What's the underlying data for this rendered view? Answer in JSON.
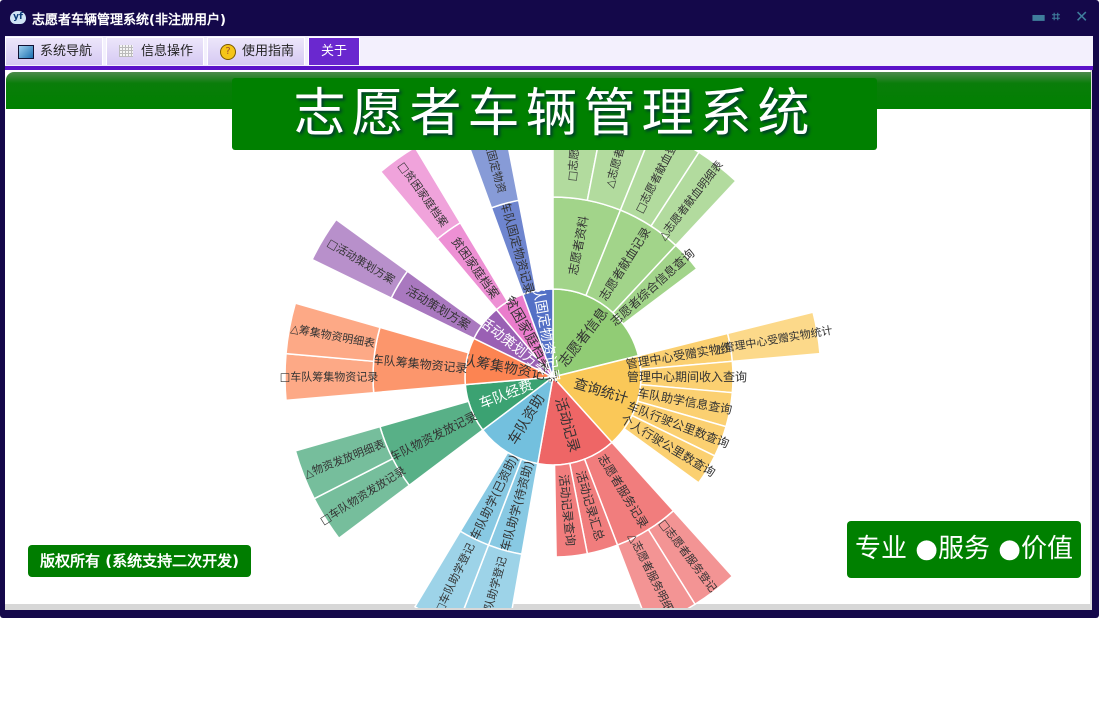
{
  "window": {
    "title": "志愿者车辆管理系统(非注册用户)",
    "app_icon": "yf",
    "controls": [
      "minimize-icon",
      "restore-icon",
      "close-icon"
    ]
  },
  "tabs": [
    {
      "label": "系统导航",
      "icon": "monitor-icon"
    },
    {
      "label": "信息操作",
      "icon": "grid-icon"
    },
    {
      "label": "使用指南",
      "icon": "help-icon"
    },
    {
      "label": "关于",
      "icon": "",
      "active": true
    }
  ],
  "banner": {
    "title": "志愿者车辆管理系统"
  },
  "footer": {
    "copyright": "版权所有 (系统支持二次开发)",
    "slogan": "专业 ●服务 ●价值"
  },
  "colors": {
    "accent": "#5b12c9",
    "banner": "#008000",
    "titlebar": "#14084a"
  },
  "chart_data": {
    "type": "sunburst",
    "palette": [
      "#91cc75",
      "#fac858",
      "#ee6666",
      "#73c0de",
      "#3ba272",
      "#fc8452",
      "#9a60b4",
      "#ea7ccc",
      "#5470c6"
    ],
    "nodes": [
      {
        "name": "志愿者信息",
        "value": 76,
        "children": [
          {
            "name": "志愿者资料",
            "value": 22,
            "children": [
              {
                "name": "□志愿者信",
                "value": 11
              },
              {
                "name": "△志愿者信",
                "value": 11
              }
            ]
          },
          {
            "name": "志愿者献血记录",
            "value": 21,
            "children": [
              {
                "name": "□志愿者献血登",
                "value": 11
              },
              {
                "name": "△志愿者献血明细表",
                "value": 10
              }
            ]
          },
          {
            "name": "志愿者综合信息查询",
            "value": 10
          }
        ]
      },
      {
        "name": "查询统计",
        "value": 62,
        "children": [
          {
            "name": "管理中心受赠实物统计",
            "value": 9,
            "children": [
              {
                "name": "△管理中心受赠实物统计",
                "value": 9
              }
            ]
          },
          {
            "name": "管理中心期间收入查询",
            "value": 10
          },
          {
            "name": "车队助学信息查询",
            "value": 11
          },
          {
            "name": "车队行驶公里数查询",
            "value": 10
          },
          {
            "name": "个人行驶公里数查询",
            "value": 10
          }
        ]
      },
      {
        "name": "活动记录",
        "value": 52,
        "children": [
          {
            "name": "志愿者服务记录",
            "value": 21,
            "children": [
              {
                "name": "□志愿者服务登记",
                "value": 10
              },
              {
                "name": "△志愿者服务明细表",
                "value": 11
              }
            ]
          },
          {
            "name": "活动记录汇总",
            "value": 10
          },
          {
            "name": "活动记录查询",
            "value": 10
          }
        ]
      },
      {
        "name": "车队资助",
        "value": 43,
        "children": [
          {
            "name": "车队助学(待资助)",
            "value": 11,
            "children": [
              {
                "name": "△车队助学登记",
                "value": 11
              }
            ]
          },
          {
            "name": "车队助学(已资助)",
            "value": 10,
            "children": [
              {
                "name": "□车队助学登记",
                "value": 10
              }
            ]
          }
        ]
      },
      {
        "name": "车队经费",
        "value": 32,
        "light": true,
        "children": [
          {
            "name": "车队物资发放记录",
            "value": 21,
            "children": [
              {
                "name": "□车队物资发放记录",
                "value": 10
              },
              {
                "name": "△物资发放明细表",
                "value": 11
              }
            ]
          }
        ]
      },
      {
        "name": "车队筹集物资记录",
        "value": 31,
        "children": [
          {
            "name": "车队筹集物资记录",
            "value": 21,
            "children": [
              {
                "name": "□车队筹集物资记录",
                "value": 10
              },
              {
                "name": "△筹集物资明细表",
                "value": 11
              }
            ]
          }
        ]
      },
      {
        "name": "活动策划方案",
        "value": 24,
        "light": true,
        "children": [
          {
            "name": "活动策划方案",
            "value": 10,
            "children": [
              {
                "name": "□活动策划方案",
                "value": 10
              }
            ]
          }
        ]
      },
      {
        "name": "贫困家庭档案",
        "value": 20,
        "children": [
          {
            "name": "贫困家庭档案",
            "value": 9,
            "children": [
              {
                "name": "□贫困家庭档案",
                "value": 9
              }
            ]
          }
        ]
      },
      {
        "name": "车队固定物资记录",
        "value": 20,
        "light": true,
        "children": [
          {
            "name": "车队固定物资记录",
            "value": 9,
            "children": [
              {
                "name": "车队固定物资",
                "value": 9
              }
            ]
          }
        ]
      }
    ]
  }
}
